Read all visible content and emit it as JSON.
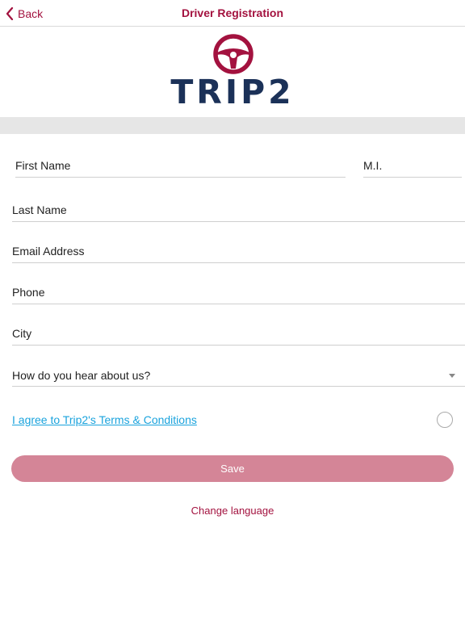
{
  "header": {
    "back_label": "Back",
    "title": "Driver Registration"
  },
  "logo": {
    "text": "TRIP2"
  },
  "form": {
    "first_name_placeholder": "First Name",
    "mi_placeholder": "M.I.",
    "last_name_placeholder": "Last Name",
    "email_placeholder": "Email Address",
    "phone_placeholder": "Phone",
    "city_placeholder": "City",
    "referral_label": "How do you hear about us?"
  },
  "terms": {
    "label": "I agree to Trip2's Terms & Conditions",
    "checked": false
  },
  "actions": {
    "save_label": "Save",
    "change_language_label": "Change language"
  },
  "colors": {
    "brand": "#a3123f",
    "logo_text": "#1b3158",
    "link": "#1aa3dd",
    "save_button": "#d48597"
  },
  "icons": {
    "back": "chevron-left-icon",
    "logo": "steering-wheel-icon",
    "dropdown": "caret-down-icon"
  }
}
